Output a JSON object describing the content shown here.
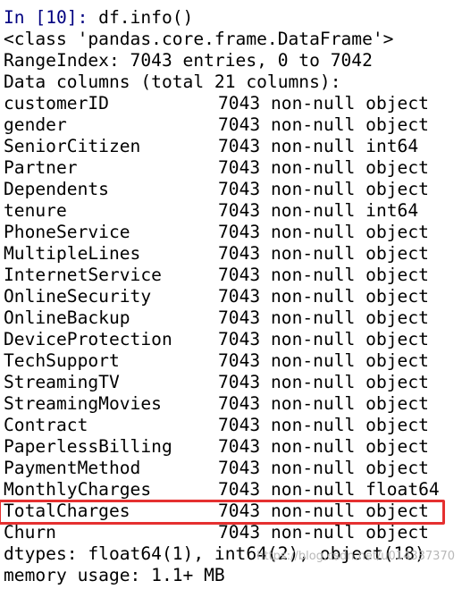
{
  "input": {
    "prompt_label": "In [",
    "prompt_number": "10",
    "prompt_end": "]: ",
    "code": "df.info()"
  },
  "output": {
    "class_line": "<class 'pandas.core.frame.DataFrame'>",
    "range_index": "RangeIndex: 7043 entries, 0 to 7042",
    "data_columns_header": "Data columns (total 21 columns):",
    "columns": [
      {
        "name": "customerID",
        "info": "7043 non-null object"
      },
      {
        "name": "gender",
        "info": "7043 non-null object"
      },
      {
        "name": "SeniorCitizen",
        "info": "7043 non-null int64"
      },
      {
        "name": "Partner",
        "info": "7043 non-null object"
      },
      {
        "name": "Dependents",
        "info": "7043 non-null object"
      },
      {
        "name": "tenure",
        "info": "7043 non-null int64"
      },
      {
        "name": "PhoneService",
        "info": "7043 non-null object"
      },
      {
        "name": "MultipleLines",
        "info": "7043 non-null object"
      },
      {
        "name": "InternetService",
        "info": "7043 non-null object"
      },
      {
        "name": "OnlineSecurity",
        "info": "7043 non-null object"
      },
      {
        "name": "OnlineBackup",
        "info": "7043 non-null object"
      },
      {
        "name": "DeviceProtection",
        "info": "7043 non-null object"
      },
      {
        "name": "TechSupport",
        "info": "7043 non-null object"
      },
      {
        "name": "StreamingTV",
        "info": "7043 non-null object"
      },
      {
        "name": "StreamingMovies",
        "info": "7043 non-null object"
      },
      {
        "name": "Contract",
        "info": "7043 non-null object"
      },
      {
        "name": "PaperlessBilling",
        "info": "7043 non-null object"
      },
      {
        "name": "PaymentMethod",
        "info": "7043 non-null object"
      },
      {
        "name": "MonthlyCharges",
        "info": "7043 non-null float64"
      },
      {
        "name": "TotalCharges",
        "info": "7043 non-null object"
      },
      {
        "name": "Churn",
        "info": "7043 non-null object"
      }
    ],
    "dtypes_line": "dtypes: float64(1), int64(2), object(18)",
    "memory_line": "memory usage: 1.1+ MB"
  },
  "highlighted_column": "TotalCharges",
  "watermark": "https://blog.csdn.net/u014337370",
  "colors": {
    "prompt": "#000080",
    "highlight_border": "#e53030"
  }
}
